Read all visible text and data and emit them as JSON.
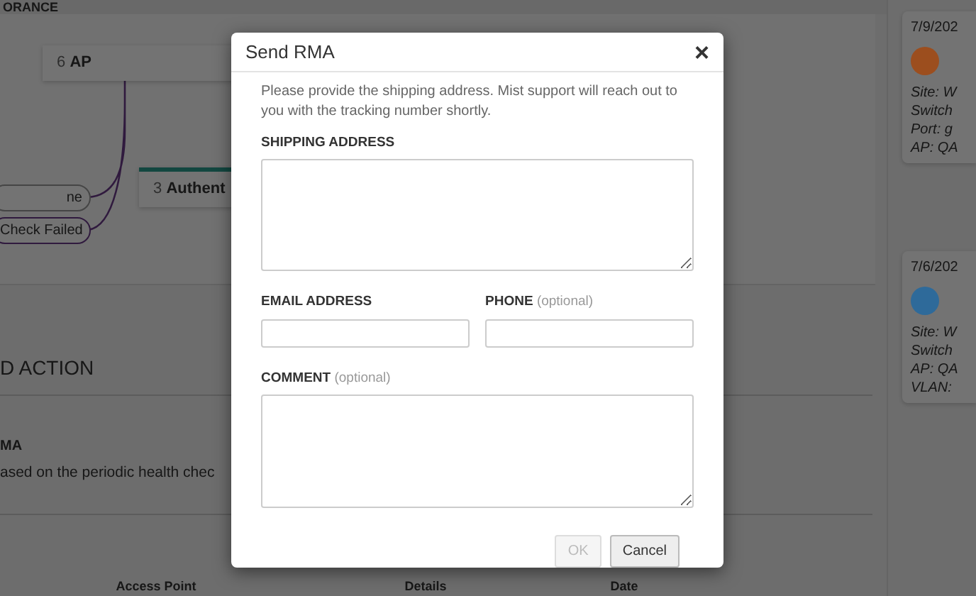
{
  "page": {
    "section_title": "ORANCE"
  },
  "diagram": {
    "nodes": [
      {
        "number": "6",
        "label": "AP",
        "kind": "plain"
      },
      {
        "number": "3",
        "label": "Authent",
        "kind": "accent"
      }
    ],
    "pills": [
      "ne",
      "Check Failed"
    ]
  },
  "action": {
    "title": "D ACTION",
    "item_title": "MA",
    "item_text": "ased on the periodic health chec",
    "table": {
      "columns": [
        "Access Point",
        "Details",
        "Date"
      ]
    }
  },
  "events": [
    {
      "date": "7/9/202",
      "color": "#9c4e1e",
      "lines": [
        "Site: W",
        "Switch",
        "Port: g",
        "AP: QA"
      ]
    },
    {
      "date": "7/6/202",
      "color": "#2e6a9a",
      "lines": [
        "Site: W",
        "Switch",
        "AP: QA",
        "VLAN:"
      ]
    }
  ],
  "dialog": {
    "title": "Send RMA",
    "close": "×",
    "intro": "Please provide the shipping address. Mist support will reach out to you with the tracking number shortly.",
    "fields": [
      {
        "label": "SHIPPING ADDRESS",
        "kind": "textarea"
      },
      {
        "label": "EMAIL ADDRESS",
        "kind": "input"
      },
      {
        "label": "PHONE",
        "hint": "(optional)",
        "kind": "input"
      },
      {
        "label": "COMMENT",
        "hint": "(optional)",
        "kind": "textarea"
      }
    ],
    "buttons": [
      {
        "label": "OK",
        "disabled": true
      },
      {
        "label": "Cancel",
        "disabled": false
      }
    ]
  }
}
